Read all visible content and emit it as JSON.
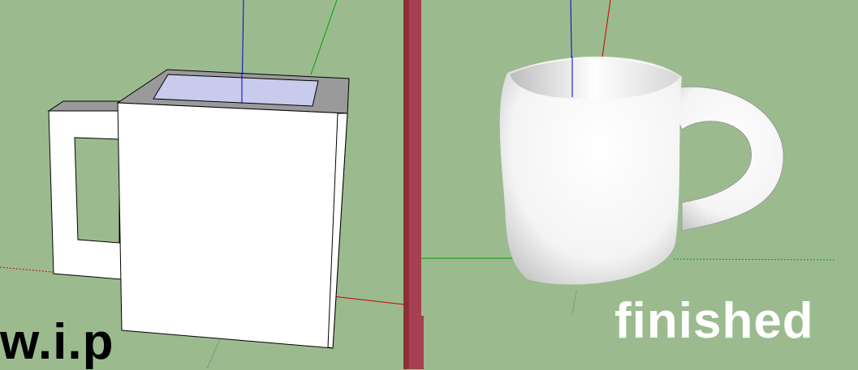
{
  "left_panel": {
    "label": "w.i.p"
  },
  "right_panel": {
    "label": "finished"
  },
  "colors": {
    "background": "#9bbb8f",
    "divider": "#a64050",
    "divider_shadow": "#8c2f36",
    "axis_red": "#cc0000",
    "axis_green": "#00a000",
    "axis_blue": "#0000cc"
  }
}
